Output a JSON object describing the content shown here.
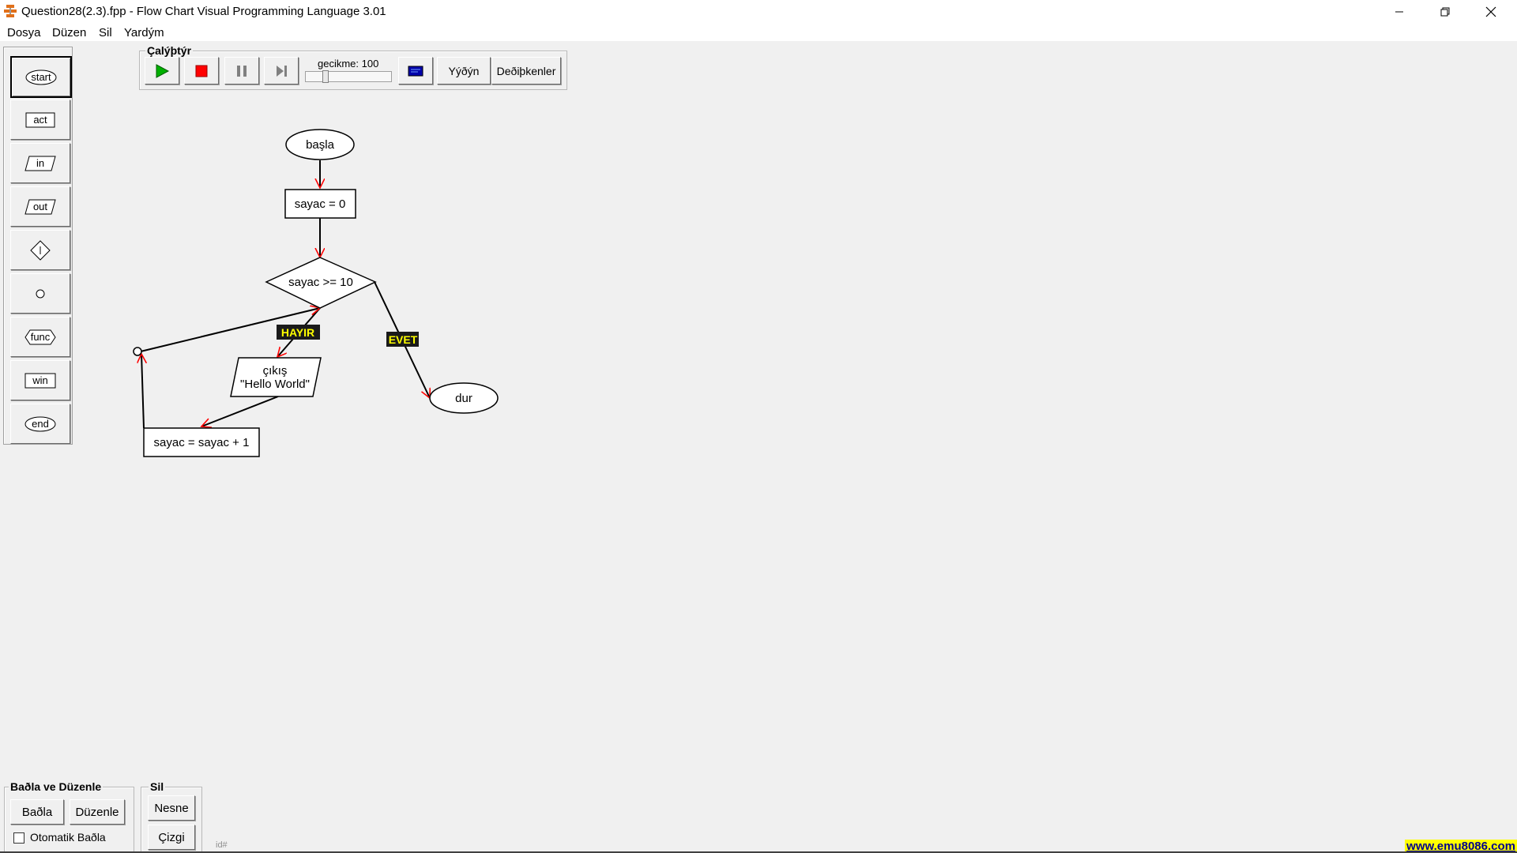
{
  "window": {
    "title": "Question28(2.3).fpp - Flow Chart Visual Programming Language 3.01",
    "controls": {
      "minimize": "minimize-icon",
      "restore": "restore-icon",
      "close": "close-icon"
    }
  },
  "menu": [
    "Dosya",
    "Düzen",
    "Sil",
    "Yardým"
  ],
  "palette": [
    {
      "label": "start",
      "icon": "terminal-oval"
    },
    {
      "label": "act",
      "icon": "rectangle"
    },
    {
      "label": "in",
      "icon": "parallelogram"
    },
    {
      "label": "out",
      "icon": "parallelogram"
    },
    {
      "label": "",
      "icon": "diamond-decision"
    },
    {
      "label": "",
      "icon": "connector-circle"
    },
    {
      "label": "func",
      "icon": "hexagon"
    },
    {
      "label": "win",
      "icon": "window-rectangle"
    },
    {
      "label": "end",
      "icon": "terminal-oval"
    }
  ],
  "run_group": {
    "label": "Çalýþtýr",
    "play": "play-icon",
    "stop": "stop-icon",
    "pause": "pause-icon",
    "step": "step-icon",
    "delay_label": "gecikme: 100",
    "screen": "screen-icon",
    "output_button": "Yýðýn",
    "variables_button": "Deðiþkenler"
  },
  "flowchart": {
    "start": "başla",
    "init": "sayac = 0",
    "decision": "sayac >= 10",
    "no_label": "HAYIR",
    "yes_label": "EVET",
    "output_line1": "çıkış",
    "output_line2": "\"Hello World\"",
    "increment": "sayac = sayac + 1",
    "end": "dur"
  },
  "connect_group": {
    "label": "Baðla ve Düzenle",
    "connect_button": "Baðla",
    "arrange_button": "Düzenle",
    "auto_connect": "Otomatik Baðla",
    "auto_connect_checked": false
  },
  "delete_group": {
    "label": "Sil",
    "object_button": "Nesne",
    "line_button": "Çizgi"
  },
  "status": {
    "id": "id#",
    "link": "www.emu8086.com"
  },
  "colors": {
    "arrow": "#ff0000",
    "tag_bg": "#1a1a1a",
    "tag_text": "#ffff00",
    "stop": "#ff0000",
    "play": "#00b000",
    "screen": "#0000aa",
    "link_bg": "#ffff00",
    "link_text": "#00008b"
  }
}
